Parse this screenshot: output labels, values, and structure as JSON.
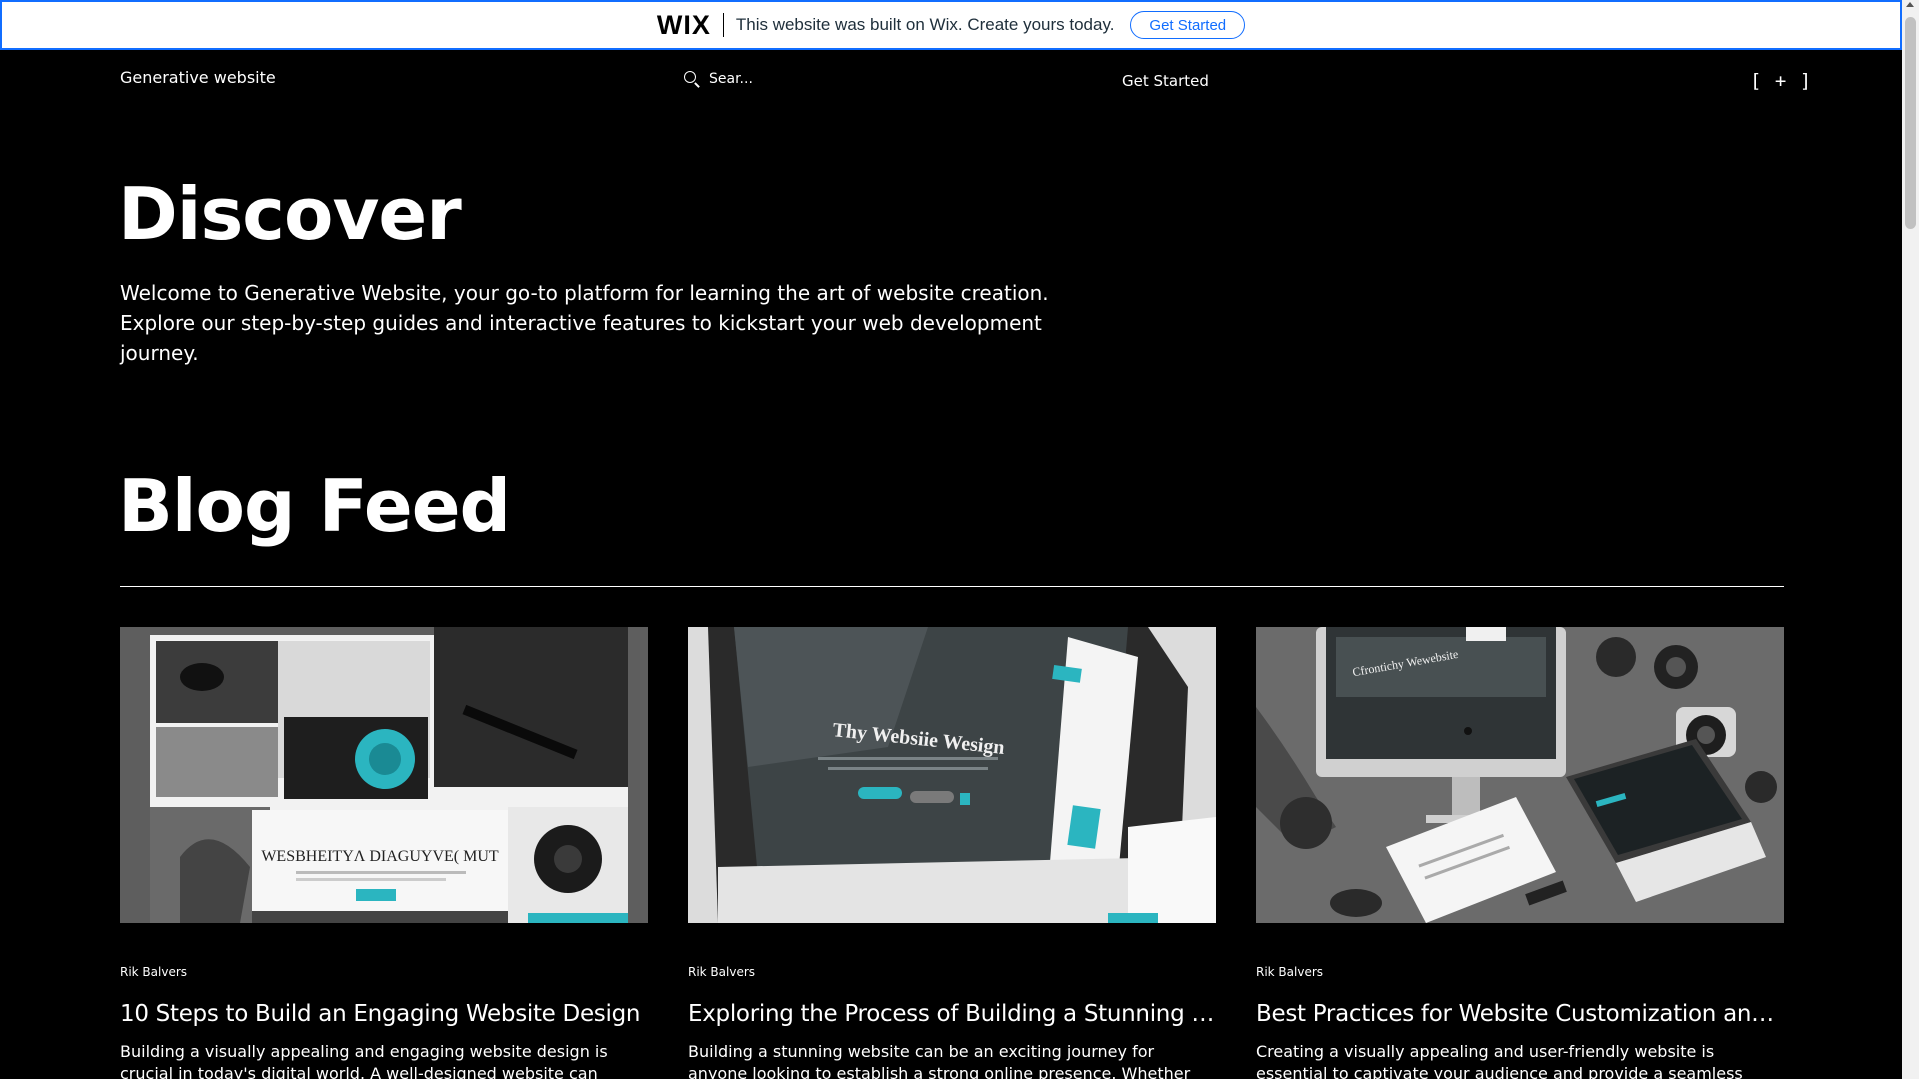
{
  "wix_banner": {
    "logo": "WIX",
    "message": "This website was built on Wix. Create yours today.",
    "button_label": "Get Started"
  },
  "header": {
    "site_name": "Generative website",
    "search_placeholder": "Sear...",
    "nav_link": "Get Started",
    "plus_label": "[ + ]"
  },
  "hero": {
    "title": "Discover",
    "description": "Welcome to Generative Website, your go-to platform for learning the art of website creation. Explore our step-by-step guides and interactive features to kickstart your web development journey."
  },
  "blog": {
    "title": "Blog Feed",
    "posts": [
      {
        "author": "Rik Balvers",
        "title": "10 Steps to Build an Engaging Website Design",
        "excerpt": "Building a visually appealing and engaging website design is crucial in today's digital world. A well-designed website can attract and",
        "image_text": "WESBHEITYɅ DIAGUYVE( MUT"
      },
      {
        "author": "Rik Balvers",
        "title": "Exploring the Process of Building a Stunning Website",
        "excerpt": "Building a stunning website can be an exciting journey for anyone looking to establish a strong online presence. Whether you are a",
        "image_text": "Thy Websiie Wesign"
      },
      {
        "author": "Rik Balvers",
        "title": "Best Practices for Website Customization and User Experience",
        "excerpt": "Creating a visually appealing and user-friendly website is essential to captivate your audience and provide a seamless browsing",
        "image_text": "Cfrontichy Wewebsite"
      }
    ]
  },
  "colors": {
    "background": "#000000",
    "accent": "#2bb5c0",
    "wix_blue": "#116dff"
  }
}
